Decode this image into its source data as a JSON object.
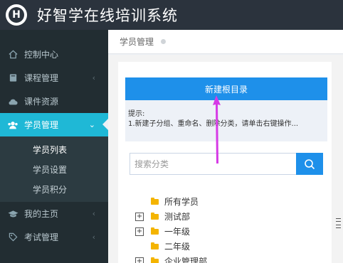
{
  "app": {
    "title": "好智学在线培训系统",
    "logo_letter": "H"
  },
  "sidebar": {
    "items": [
      {
        "label": "控制中心",
        "icon": "home-icon"
      },
      {
        "label": "课程管理",
        "icon": "book-icon"
      },
      {
        "label": "课件资源",
        "icon": "cloud-icon"
      },
      {
        "label": "学员管理",
        "icon": "users-icon"
      }
    ],
    "submenu": [
      {
        "label": "学员列表"
      },
      {
        "label": "学员设置"
      },
      {
        "label": "学员积分"
      }
    ],
    "bottom_items": [
      {
        "label": "我的主页",
        "icon": "graduation-cap-icon"
      },
      {
        "label": "考试管理",
        "icon": "tag-icon"
      }
    ]
  },
  "breadcrumb": {
    "current": "学员管理"
  },
  "main": {
    "new_root_button": "新建根目录",
    "hint_title": "提示:",
    "hint_text": "1.新建子分组、重命名、删除分类，请单击右键操作...",
    "search_placeholder": "搜索分类",
    "tree": [
      {
        "label": "所有学员",
        "expandable": false
      },
      {
        "label": "测试部",
        "expandable": true,
        "expander": "+"
      },
      {
        "label": "一年级",
        "expandable": true,
        "expander": "+"
      },
      {
        "label": "二年级",
        "expandable": false
      },
      {
        "label": "企业管理部",
        "expandable": true,
        "expander": "+"
      }
    ]
  },
  "colors": {
    "header_bg": "#2b333d",
    "sidebar_bg": "#222d32",
    "active_item": "#1fb8d6",
    "primary_button": "#1e90ea",
    "folder": "#f4b400",
    "annotation_arrow": "#d63ae6"
  }
}
